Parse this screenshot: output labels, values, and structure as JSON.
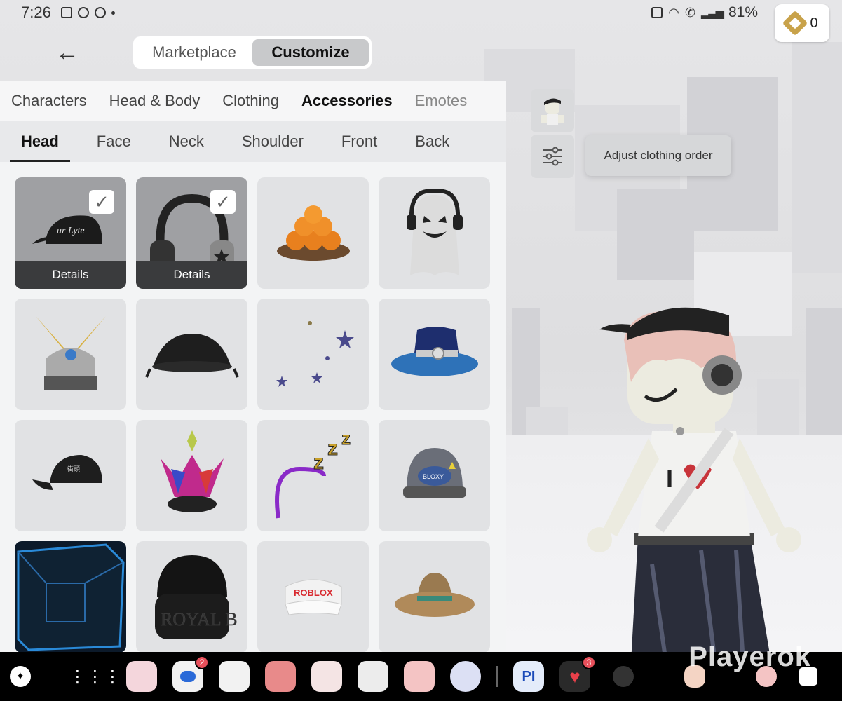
{
  "status": {
    "time": "7:26",
    "battery": "81%"
  },
  "robux": {
    "count": "0"
  },
  "nav": {
    "tabs": [
      "Marketplace",
      "Customize"
    ],
    "active": 1
  },
  "categories": [
    "Characters",
    "Head & Body",
    "Clothing",
    "Accessories",
    "Emotes"
  ],
  "subcategories": [
    "Head",
    "Face",
    "Neck",
    "Shoulder",
    "Front",
    "Back"
  ],
  "items": [
    {
      "name": "black-cap",
      "selected": true,
      "details": "Details"
    },
    {
      "name": "headphones",
      "selected": true,
      "details": "Details"
    },
    {
      "name": "orange-bowl"
    },
    {
      "name": "ghost-headphones"
    },
    {
      "name": "samurai-helmet"
    },
    {
      "name": "black-beret"
    },
    {
      "name": "moon-stars"
    },
    {
      "name": "blue-fedora"
    },
    {
      "name": "black-baseball-cap"
    },
    {
      "name": "crown"
    },
    {
      "name": "zzz-headband"
    },
    {
      "name": "hard-hat"
    },
    {
      "name": "blue-cube"
    },
    {
      "name": "royal-beanie"
    },
    {
      "name": "roblox-visor"
    },
    {
      "name": "straw-hat"
    }
  ],
  "tooltip": {
    "text": "Adjust clothing order"
  },
  "taskbar": {
    "badges": {
      "messages": "2",
      "hearts": "3"
    }
  },
  "watermark": "Playerok",
  "colors": {
    "accent": "#c8c9cb",
    "details_bg": "#3a3b3d",
    "taskbar_bg": "#000000",
    "badge": "#e8505b"
  }
}
